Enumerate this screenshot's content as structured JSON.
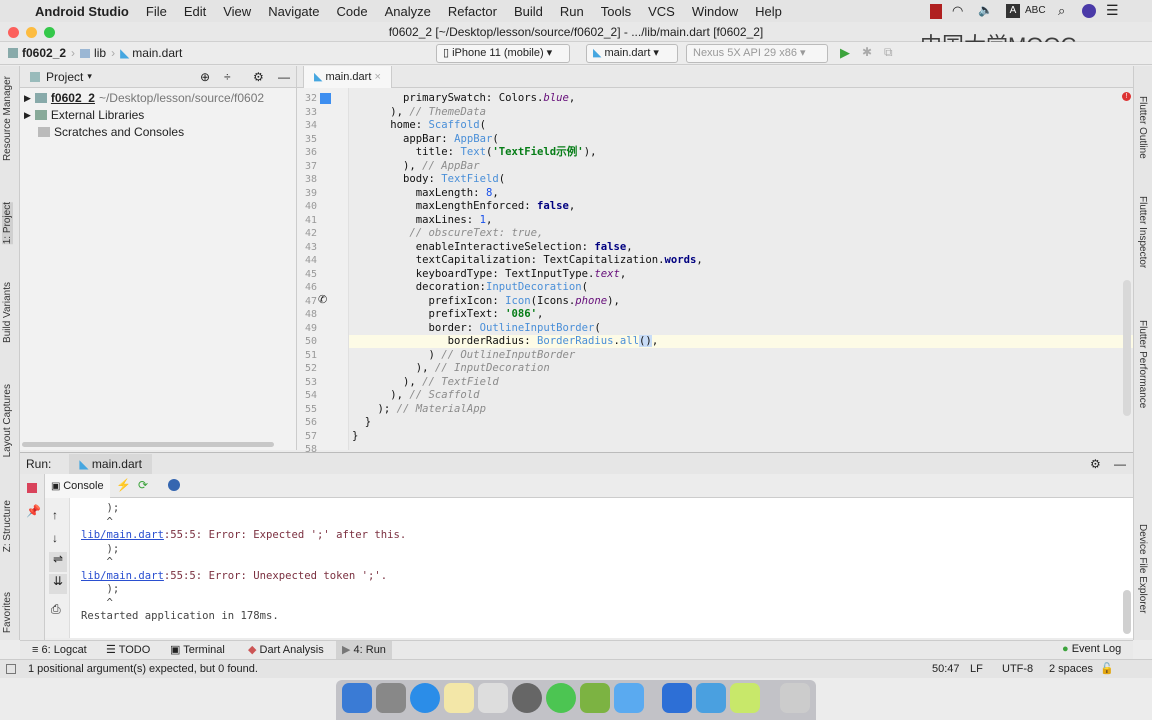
{
  "menubar": {
    "app": "Android Studio",
    "items": [
      "File",
      "Edit",
      "View",
      "Navigate",
      "Code",
      "Analyze",
      "Refactor",
      "Build",
      "Run",
      "Tools",
      "VCS",
      "Window",
      "Help"
    ],
    "input_method": "ABC"
  },
  "window": {
    "title": "f0602_2 [~/Desktop/lesson/source/f0602_2] - .../lib/main.dart [f0602_2]"
  },
  "watermark": "中国大学MOOC",
  "breadcrumb": [
    "f0602_2",
    "lib",
    "main.dart"
  ],
  "toolbar": {
    "device": "iPhone 11 (mobile)",
    "run_config": "main.dart",
    "emulator": "Nexus 5X API 29 x86"
  },
  "project": {
    "header": "Project",
    "items": [
      {
        "name": "f0602_2",
        "path": "~/Desktop/lesson/source/f0602"
      },
      {
        "name": "External Libraries"
      },
      {
        "name": "Scratches and Consoles"
      }
    ]
  },
  "left_tabs": [
    "Resource Manager",
    "1: Project",
    "Build Variants",
    "Layout Captures",
    "Z: Structure",
    "Favorites"
  ],
  "right_tabs": [
    "Flutter Outline",
    "Flutter Inspector",
    "Flutter Performance",
    "Device File Explorer"
  ],
  "editor": {
    "tab": "main.dart",
    "lines": [
      {
        "n": "32",
        "tokens": [
          [
            "        primarySwatch: Colors.",
            ""
          ],
          [
            "blue",
            "it"
          ],
          [
            ",",
            ""
          ]
        ]
      },
      {
        "n": "33",
        "tokens": [
          [
            "      ), ",
            ""
          ],
          [
            "// ThemeData",
            "cm"
          ]
        ]
      },
      {
        "n": "34",
        "tokens": [
          [
            "      home: ",
            ""
          ],
          [
            "Scaffold",
            "ty"
          ],
          [
            "(",
            ""
          ]
        ]
      },
      {
        "n": "35",
        "tokens": [
          [
            "        appBar: ",
            ""
          ],
          [
            "AppBar",
            "ty"
          ],
          [
            "(",
            ""
          ]
        ]
      },
      {
        "n": "36",
        "tokens": [
          [
            "          title: ",
            ""
          ],
          [
            "Text",
            "ty"
          ],
          [
            "(",
            ""
          ],
          [
            "'TextField示例'",
            "str"
          ],
          [
            "),",
            ""
          ]
        ]
      },
      {
        "n": "37",
        "tokens": [
          [
            "        ), ",
            ""
          ],
          [
            "// AppBar",
            "cm"
          ]
        ]
      },
      {
        "n": "38",
        "tokens": [
          [
            "        body: ",
            ""
          ],
          [
            "TextField",
            "ty"
          ],
          [
            "(",
            ""
          ]
        ]
      },
      {
        "n": "39",
        "tokens": [
          [
            "          maxLength: ",
            ""
          ],
          [
            "8",
            "num"
          ],
          [
            ",",
            ""
          ]
        ]
      },
      {
        "n": "40",
        "tokens": [
          [
            "          maxLengthEnforced: ",
            ""
          ],
          [
            "false",
            "kw"
          ],
          [
            ",",
            ""
          ]
        ]
      },
      {
        "n": "41",
        "tokens": [
          [
            "          maxLines: ",
            ""
          ],
          [
            "1",
            "num"
          ],
          [
            ",",
            ""
          ]
        ]
      },
      {
        "n": "42",
        "tokens": [
          [
            "         ",
            ""
          ],
          [
            "// obscureText: true,",
            "cm"
          ]
        ]
      },
      {
        "n": "43",
        "tokens": [
          [
            "          enableInteractiveSelection: ",
            ""
          ],
          [
            "false",
            "kw"
          ],
          [
            ",",
            ""
          ]
        ]
      },
      {
        "n": "44",
        "tokens": [
          [
            "          textCapitalization: TextCapitalization.",
            ""
          ],
          [
            "words",
            "kw"
          ],
          [
            ",",
            ""
          ]
        ]
      },
      {
        "n": "45",
        "tokens": [
          [
            "          keyboardType: TextInputType.",
            ""
          ],
          [
            "text",
            "it"
          ],
          [
            ",",
            ""
          ]
        ]
      },
      {
        "n": "46",
        "tokens": [
          [
            "          decoration:",
            ""
          ],
          [
            "InputDecoration",
            "ty"
          ],
          [
            "(",
            ""
          ]
        ]
      },
      {
        "n": "47",
        "tokens": [
          [
            "            prefixIcon: ",
            ""
          ],
          [
            "Icon",
            "ty"
          ],
          [
            "(Icons.",
            ""
          ],
          [
            "phone",
            "it"
          ],
          [
            "),",
            ""
          ]
        ]
      },
      {
        "n": "48",
        "tokens": [
          [
            "            prefixText: ",
            ""
          ],
          [
            "'086'",
            "str"
          ],
          [
            ",",
            ""
          ]
        ]
      },
      {
        "n": "49",
        "tokens": [
          [
            "            border: ",
            ""
          ],
          [
            "OutlineInputBorder",
            "ty"
          ],
          [
            "(",
            ""
          ]
        ]
      },
      {
        "n": "50",
        "tokens": [
          [
            "               borderRadius: ",
            ""
          ],
          [
            "BorderRadius",
            "ty"
          ],
          [
            ".",
            ""
          ],
          [
            "all",
            "ty"
          ],
          [
            "()",
            "sel"
          ],
          [
            ",",
            ""
          ]
        ]
      },
      {
        "n": "51",
        "tokens": [
          [
            "            ) ",
            ""
          ],
          [
            "// OutlineInputBorder",
            "cm"
          ]
        ]
      },
      {
        "n": "52",
        "tokens": [
          [
            "          ), ",
            ""
          ],
          [
            "// InputDecoration",
            "cm"
          ]
        ]
      },
      {
        "n": "53",
        "tokens": [
          [
            "        ), ",
            ""
          ],
          [
            "// TextField",
            "cm"
          ]
        ]
      },
      {
        "n": "54",
        "tokens": [
          [
            "      ), ",
            ""
          ],
          [
            "// Scaffold",
            "cm"
          ]
        ]
      },
      {
        "n": "55",
        "tokens": [
          [
            "    ); ",
            ""
          ],
          [
            "// MaterialApp",
            "cm"
          ]
        ]
      },
      {
        "n": "56",
        "tokens": [
          [
            "  }",
            ""
          ]
        ]
      },
      {
        "n": "57",
        "tokens": [
          [
            "}",
            ""
          ]
        ]
      },
      {
        "n": "58",
        "tokens": []
      }
    ]
  },
  "run": {
    "label": "Run:",
    "config": "main.dart",
    "console_tab": "Console"
  },
  "console": {
    "lines": [
      {
        "text": "    );"
      },
      {
        "text": "    ^"
      },
      {
        "link": "lib/main.dart",
        "text": ":55:5: Error: Expected ';' after this."
      },
      {
        "text": "    );"
      },
      {
        "text": "    ^"
      },
      {
        "link": "lib/main.dart",
        "text": ":55:5: Error: Unexpected token ';'."
      },
      {
        "text": "    );"
      },
      {
        "text": "    ^"
      },
      {
        "text": "Restarted application in 178ms."
      }
    ]
  },
  "bottom_tabs": [
    "6: Logcat",
    "TODO",
    "Terminal",
    "Dart Analysis",
    "4: Run"
  ],
  "event_log": "Event Log",
  "status": {
    "message": "1 positional argument(s) expected, but 0 found.",
    "position": "50:47",
    "line_sep": "LF",
    "encoding": "UTF-8",
    "indent": "2 spaces"
  }
}
